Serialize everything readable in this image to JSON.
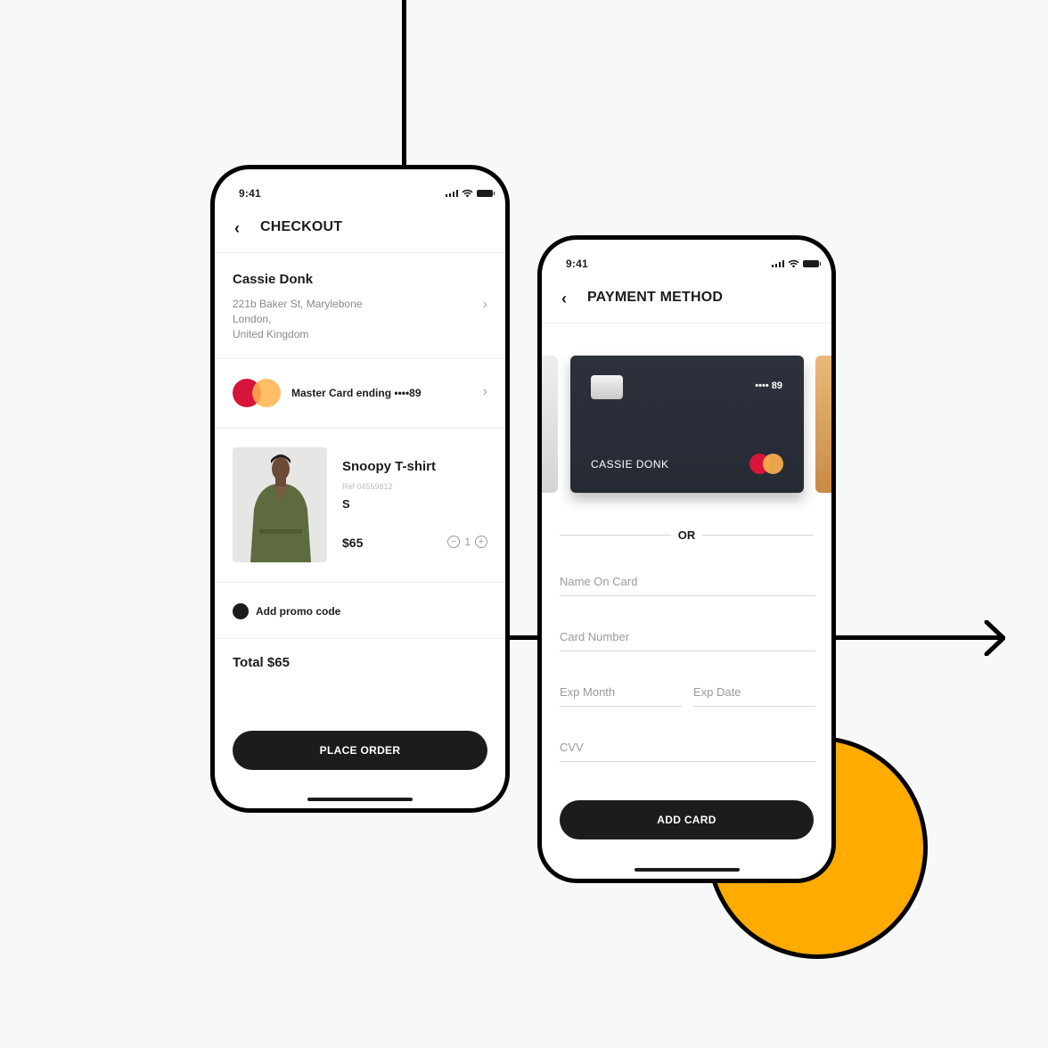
{
  "colors": {
    "background": "#f7f8fa",
    "accent_circle": "#ffab00",
    "button": "#1b1c1e",
    "card": "#2a2e38",
    "mastercard_red": "#d7143a",
    "mastercard_orange": "#ffb24d"
  },
  "checkout": {
    "status_time": "9:41",
    "title": "CHECKOUT",
    "back_icon": "‹",
    "customer": {
      "name": "Cassie Donk",
      "address_line1": "221b Baker St, Marylebone",
      "address_line2": "London,",
      "address_line3": "United Kingdom"
    },
    "payment": {
      "label": "Master Card ending",
      "last_digits": "••••89"
    },
    "product": {
      "name": "Snoopy T-shirt",
      "ref": "Ref 04559812",
      "size": "S",
      "price": "$65",
      "quantity": "1",
      "minus": "−",
      "plus": "+"
    },
    "promo_label": "Add promo code",
    "total": "Total $65",
    "place_order_label": "PLACE ORDER",
    "chevron": "›"
  },
  "payment_method": {
    "status_time": "9:41",
    "title": "PAYMENT METHOD",
    "back_icon": "‹",
    "card": {
      "number": "•••• 89",
      "holder": "CASSIE DONK"
    },
    "or_label": "OR",
    "fields": {
      "name_on_card": "Name On Card",
      "card_number": "Card Number",
      "exp_month": "Exp Month",
      "exp_date": "Exp Date",
      "cvv": "CVV"
    },
    "add_card_label": "ADD CARD"
  }
}
